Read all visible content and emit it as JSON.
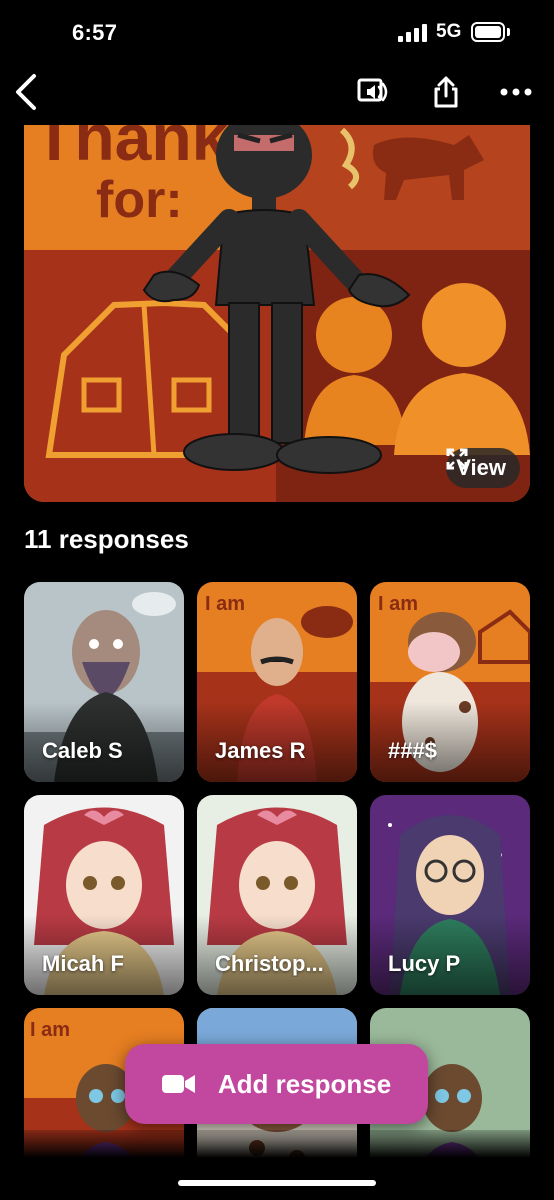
{
  "status": {
    "time": "6:57",
    "network": "5G"
  },
  "nav": {
    "back_icon": "chevron-left-icon",
    "captions_icon": "captions-audio-icon",
    "share_icon": "share-icon",
    "more_icon": "more-icon"
  },
  "hero": {
    "poster_line1": "Thank",
    "poster_line2": "for:",
    "view_label": "View"
  },
  "responses": {
    "count_label": "11 responses",
    "items": [
      {
        "name": "Caleb S"
      },
      {
        "name": "James R"
      },
      {
        "name": "###$"
      },
      {
        "name": "Micah F"
      },
      {
        "name": "Christop..."
      },
      {
        "name": "Lucy P"
      },
      {
        "name": ""
      },
      {
        "name": ""
      },
      {
        "name": ""
      }
    ]
  },
  "add_response": {
    "label": "Add response",
    "icon": "video-camera-icon"
  },
  "colors": {
    "accent": "#c1479f",
    "poster_orange": "#e67e22",
    "poster_red": "#9b2c16"
  }
}
